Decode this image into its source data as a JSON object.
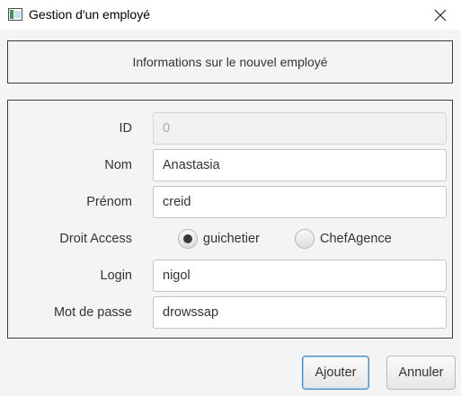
{
  "window": {
    "title": "Gestion d'un employé"
  },
  "header": {
    "text": "Informations sur le nouvel employé"
  },
  "form": {
    "id": {
      "label": "ID",
      "value": "0"
    },
    "nom": {
      "label": "Nom",
      "value": "Anastasia"
    },
    "prenom": {
      "label": "Prénom",
      "value": "creid"
    },
    "droit_access": {
      "label": "Droit Access",
      "options": [
        {
          "label": "guichetier",
          "selected": true
        },
        {
          "label": "ChefAgence",
          "selected": false
        }
      ]
    },
    "login": {
      "label": "Login",
      "value": "nigol"
    },
    "mot_de_passe": {
      "label": "Mot de passe",
      "value": "drowssap"
    }
  },
  "buttons": {
    "ajouter": "Ajouter",
    "annuler": "Annuler"
  },
  "icons": {
    "app": "app-window-icon",
    "close": "close-icon"
  }
}
